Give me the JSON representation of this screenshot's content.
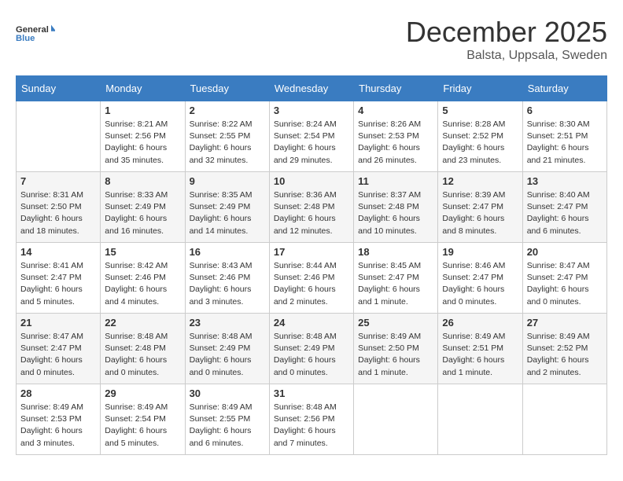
{
  "header": {
    "logo_line1": "General",
    "logo_line2": "Blue",
    "month": "December 2025",
    "location": "Balsta, Uppsala, Sweden"
  },
  "days_of_week": [
    "Sunday",
    "Monday",
    "Tuesday",
    "Wednesday",
    "Thursday",
    "Friday",
    "Saturday"
  ],
  "weeks": [
    [
      {
        "day": "",
        "info": ""
      },
      {
        "day": "1",
        "info": "Sunrise: 8:21 AM\nSunset: 2:56 PM\nDaylight: 6 hours\nand 35 minutes."
      },
      {
        "day": "2",
        "info": "Sunrise: 8:22 AM\nSunset: 2:55 PM\nDaylight: 6 hours\nand 32 minutes."
      },
      {
        "day": "3",
        "info": "Sunrise: 8:24 AM\nSunset: 2:54 PM\nDaylight: 6 hours\nand 29 minutes."
      },
      {
        "day": "4",
        "info": "Sunrise: 8:26 AM\nSunset: 2:53 PM\nDaylight: 6 hours\nand 26 minutes."
      },
      {
        "day": "5",
        "info": "Sunrise: 8:28 AM\nSunset: 2:52 PM\nDaylight: 6 hours\nand 23 minutes."
      },
      {
        "day": "6",
        "info": "Sunrise: 8:30 AM\nSunset: 2:51 PM\nDaylight: 6 hours\nand 21 minutes."
      }
    ],
    [
      {
        "day": "7",
        "info": "Sunrise: 8:31 AM\nSunset: 2:50 PM\nDaylight: 6 hours\nand 18 minutes."
      },
      {
        "day": "8",
        "info": "Sunrise: 8:33 AM\nSunset: 2:49 PM\nDaylight: 6 hours\nand 16 minutes."
      },
      {
        "day": "9",
        "info": "Sunrise: 8:35 AM\nSunset: 2:49 PM\nDaylight: 6 hours\nand 14 minutes."
      },
      {
        "day": "10",
        "info": "Sunrise: 8:36 AM\nSunset: 2:48 PM\nDaylight: 6 hours\nand 12 minutes."
      },
      {
        "day": "11",
        "info": "Sunrise: 8:37 AM\nSunset: 2:48 PM\nDaylight: 6 hours\nand 10 minutes."
      },
      {
        "day": "12",
        "info": "Sunrise: 8:39 AM\nSunset: 2:47 PM\nDaylight: 6 hours\nand 8 minutes."
      },
      {
        "day": "13",
        "info": "Sunrise: 8:40 AM\nSunset: 2:47 PM\nDaylight: 6 hours\nand 6 minutes."
      }
    ],
    [
      {
        "day": "14",
        "info": "Sunrise: 8:41 AM\nSunset: 2:47 PM\nDaylight: 6 hours\nand 5 minutes."
      },
      {
        "day": "15",
        "info": "Sunrise: 8:42 AM\nSunset: 2:46 PM\nDaylight: 6 hours\nand 4 minutes."
      },
      {
        "day": "16",
        "info": "Sunrise: 8:43 AM\nSunset: 2:46 PM\nDaylight: 6 hours\nand 3 minutes."
      },
      {
        "day": "17",
        "info": "Sunrise: 8:44 AM\nSunset: 2:46 PM\nDaylight: 6 hours\nand 2 minutes."
      },
      {
        "day": "18",
        "info": "Sunrise: 8:45 AM\nSunset: 2:47 PM\nDaylight: 6 hours\nand 1 minute."
      },
      {
        "day": "19",
        "info": "Sunrise: 8:46 AM\nSunset: 2:47 PM\nDaylight: 6 hours\nand 0 minutes."
      },
      {
        "day": "20",
        "info": "Sunrise: 8:47 AM\nSunset: 2:47 PM\nDaylight: 6 hours\nand 0 minutes."
      }
    ],
    [
      {
        "day": "21",
        "info": "Sunrise: 8:47 AM\nSunset: 2:47 PM\nDaylight: 6 hours\nand 0 minutes."
      },
      {
        "day": "22",
        "info": "Sunrise: 8:48 AM\nSunset: 2:48 PM\nDaylight: 6 hours\nand 0 minutes."
      },
      {
        "day": "23",
        "info": "Sunrise: 8:48 AM\nSunset: 2:49 PM\nDaylight: 6 hours\nand 0 minutes."
      },
      {
        "day": "24",
        "info": "Sunrise: 8:48 AM\nSunset: 2:49 PM\nDaylight: 6 hours\nand 0 minutes."
      },
      {
        "day": "25",
        "info": "Sunrise: 8:49 AM\nSunset: 2:50 PM\nDaylight: 6 hours\nand 1 minute."
      },
      {
        "day": "26",
        "info": "Sunrise: 8:49 AM\nSunset: 2:51 PM\nDaylight: 6 hours\nand 1 minute."
      },
      {
        "day": "27",
        "info": "Sunrise: 8:49 AM\nSunset: 2:52 PM\nDaylight: 6 hours\nand 2 minutes."
      }
    ],
    [
      {
        "day": "28",
        "info": "Sunrise: 8:49 AM\nSunset: 2:53 PM\nDaylight: 6 hours\nand 3 minutes."
      },
      {
        "day": "29",
        "info": "Sunrise: 8:49 AM\nSunset: 2:54 PM\nDaylight: 6 hours\nand 5 minutes."
      },
      {
        "day": "30",
        "info": "Sunrise: 8:49 AM\nSunset: 2:55 PM\nDaylight: 6 hours\nand 6 minutes."
      },
      {
        "day": "31",
        "info": "Sunrise: 8:48 AM\nSunset: 2:56 PM\nDaylight: 6 hours\nand 7 minutes."
      },
      {
        "day": "",
        "info": ""
      },
      {
        "day": "",
        "info": ""
      },
      {
        "day": "",
        "info": ""
      }
    ]
  ]
}
